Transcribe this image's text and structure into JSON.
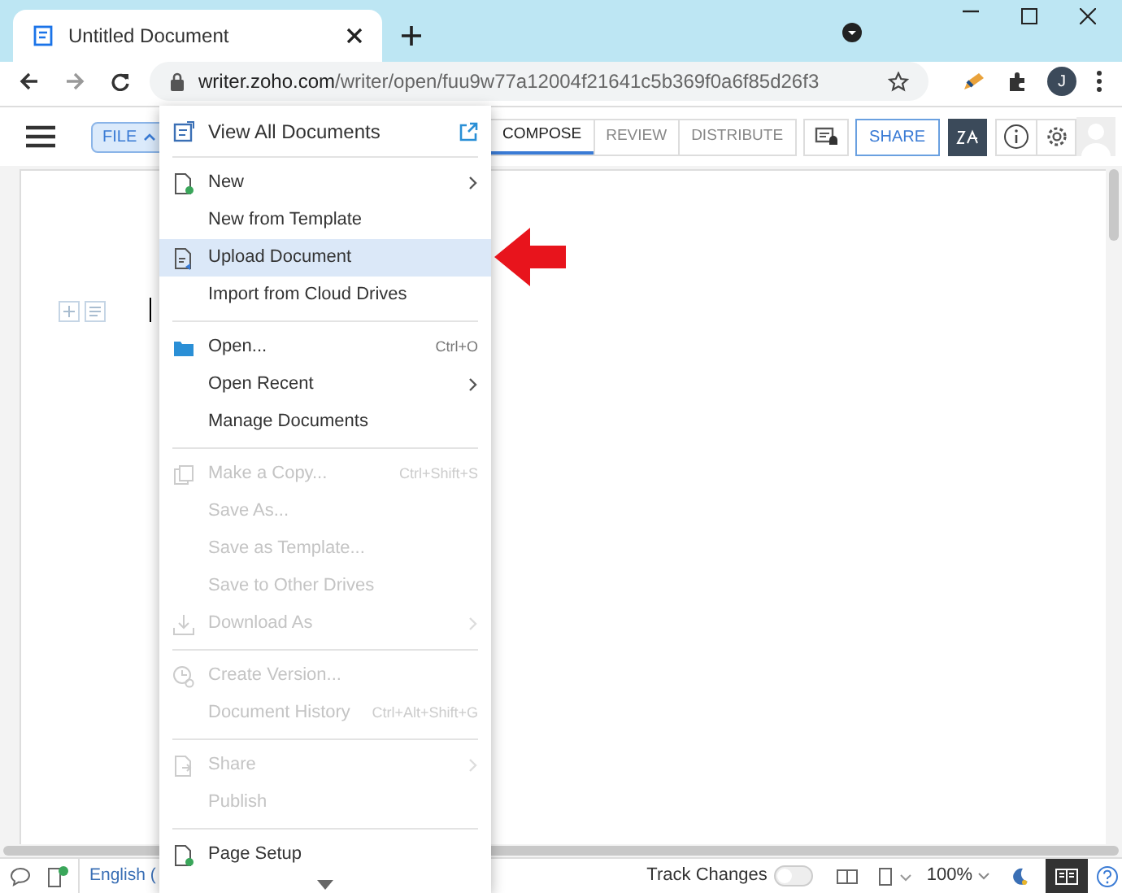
{
  "browser": {
    "tab": {
      "title": "Untitled Document"
    },
    "address": {
      "host": "writer.zoho.com",
      "path": "/writer/open/fuu9w77a12004f21641c5b369f0a6f85d26f3"
    },
    "profile": "J"
  },
  "toolbar": {
    "file_button": {
      "label": "FILE",
      "expanded": true
    },
    "tabs": [
      {
        "label": "COMPOSE",
        "selected": true
      },
      {
        "label": "REVIEW",
        "selected": false
      },
      {
        "label": "DISTRIBUTE",
        "selected": false
      }
    ],
    "share": "SHARE"
  },
  "file_menu": {
    "groups": [
      [
        {
          "label": "View All Documents",
          "external": true,
          "disabled": false,
          "selected": false
        }
      ],
      [
        {
          "label": "New",
          "submenu": true,
          "disabled": false,
          "selected": false
        },
        {
          "label": "New from Template",
          "disabled": false,
          "selected": false
        },
        {
          "label": "Upload Document",
          "disabled": false,
          "selected": true
        },
        {
          "label": "Import from Cloud Drives",
          "disabled": false,
          "selected": false
        }
      ],
      [
        {
          "label": "Open...",
          "shortcut": "Ctrl+O",
          "disabled": false,
          "selected": false
        },
        {
          "label": "Open Recent",
          "submenu": true,
          "disabled": false,
          "selected": false
        },
        {
          "label": "Manage Documents",
          "disabled": false,
          "selected": false
        }
      ],
      [
        {
          "label": "Make a Copy...",
          "shortcut": "Ctrl+Shift+S",
          "disabled": true,
          "selected": false
        },
        {
          "label": "Save As...",
          "disabled": true,
          "selected": false
        },
        {
          "label": "Save as Template...",
          "disabled": true,
          "selected": false
        },
        {
          "label": "Save to Other Drives",
          "disabled": true,
          "selected": false
        },
        {
          "label": "Download As",
          "submenu": true,
          "disabled": true,
          "selected": false
        }
      ],
      [
        {
          "label": "Create Version...",
          "disabled": true,
          "selected": false
        },
        {
          "label": "Document History",
          "shortcut": "Ctrl+Alt+Shift+G",
          "disabled": true,
          "selected": false
        }
      ],
      [
        {
          "label": "Share",
          "submenu": true,
          "disabled": true,
          "selected": false
        },
        {
          "label": "Publish",
          "disabled": true,
          "selected": false
        }
      ],
      [
        {
          "label": "Page Setup",
          "disabled": false,
          "selected": false
        }
      ]
    ]
  },
  "status_bar": {
    "language": "English (",
    "track_changes": {
      "label": "Track Changes",
      "on": false
    },
    "zoom": "100%",
    "reading_mode": {
      "selected": true
    }
  }
}
